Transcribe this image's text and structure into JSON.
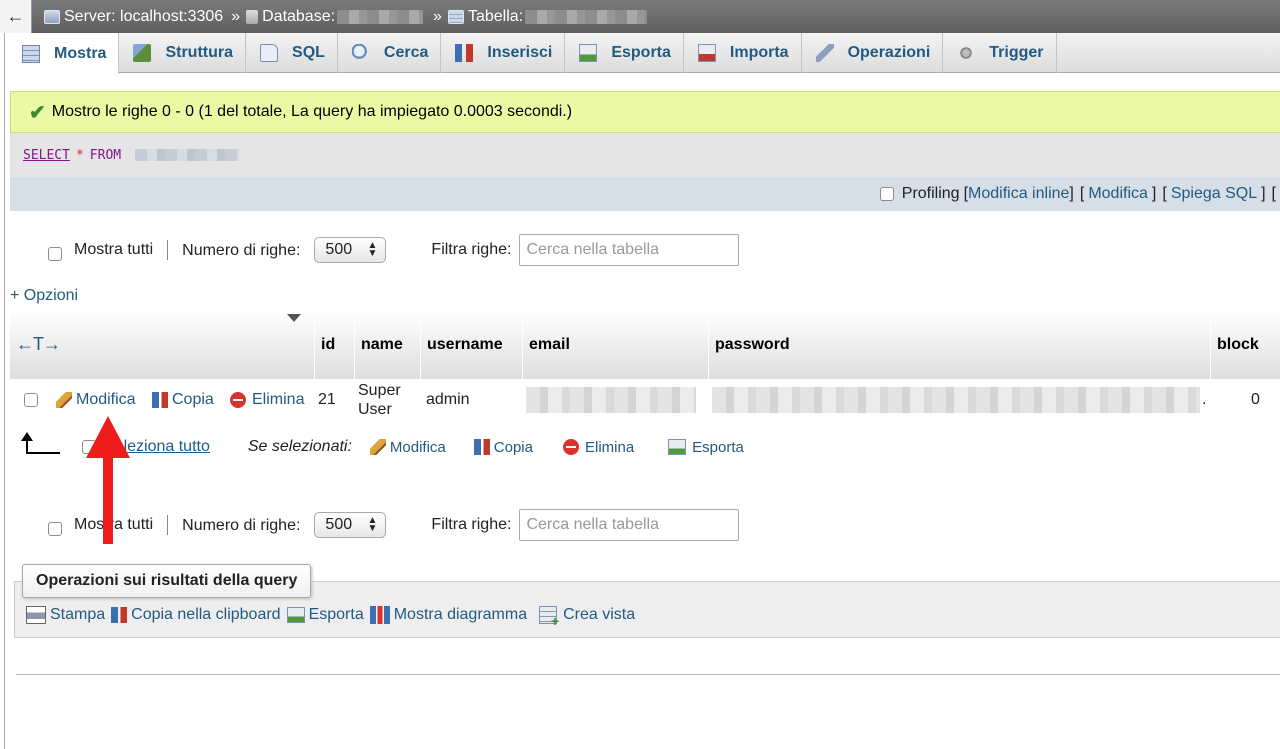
{
  "breadcrumb": {
    "back": "←",
    "server": "Server: localhost:3306",
    "database_label": "Database:",
    "table_label": "Tabella:",
    "sep": "»"
  },
  "tabs": [
    {
      "label": "Mostra",
      "icon": "browse-icon"
    },
    {
      "label": "Struttura",
      "icon": "structure-icon"
    },
    {
      "label": "SQL",
      "icon": "sql-icon"
    },
    {
      "label": "Cerca",
      "icon": "search-icon"
    },
    {
      "label": "Inserisci",
      "icon": "insert-icon"
    },
    {
      "label": "Esporta",
      "icon": "export-icon"
    },
    {
      "label": "Importa",
      "icon": "import-icon"
    },
    {
      "label": "Operazioni",
      "icon": "wrench-icon"
    },
    {
      "label": "Trigger",
      "icon": "trigger-icon"
    }
  ],
  "success": {
    "message": "Mostro le righe 0 - 0 (1 del totale, La query ha impiegato 0.0003 secondi.)"
  },
  "sql": {
    "select": "SELECT",
    "star": "*",
    "from": "FROM"
  },
  "profbar": {
    "profiling": "Profiling",
    "open1": "[",
    "inline_edit": "Modifica inline",
    "close1": "]",
    "open2": "[",
    "edit": "Modifica",
    "close2": "]",
    "open3": "[",
    "explain": "Spiega SQL",
    "close3": "]",
    "open4": "["
  },
  "nav": {
    "show_all": "Mostra tutti",
    "rows_label": "Numero di righe:",
    "rows_value": "500",
    "filter_label": "Filtra righe:",
    "filter_placeholder": "Cerca nella tabella"
  },
  "options_link": "+ Opzioni",
  "table": {
    "columns": [
      "id",
      "name",
      "username",
      "email",
      "password",
      "block"
    ],
    "col_arrows": "←T→",
    "row": {
      "edit": "Modifica",
      "copy": "Copia",
      "delete": "Elimina",
      "id": "21",
      "name": "Super User",
      "username": "admin",
      "password_tail": ".",
      "block": "0"
    }
  },
  "bulk": {
    "select_all": "Seleziona tutto",
    "if_selected": "Se selezionati:",
    "edit": "Modifica",
    "copy": "Copia",
    "delete": "Elimina",
    "export": "Esporta"
  },
  "query_ops": {
    "legend": "Operazioni sui risultati della query",
    "print": "Stampa",
    "copy_clipboard": "Copia nella clipboard",
    "export": "Esporta",
    "chart": "Mostra diagramma",
    "create_view": "Crea vista"
  },
  "colors": {
    "link": "#235a81",
    "success_bg": "#ebf8a4",
    "annotation_arrow": "#ee1c1c"
  }
}
